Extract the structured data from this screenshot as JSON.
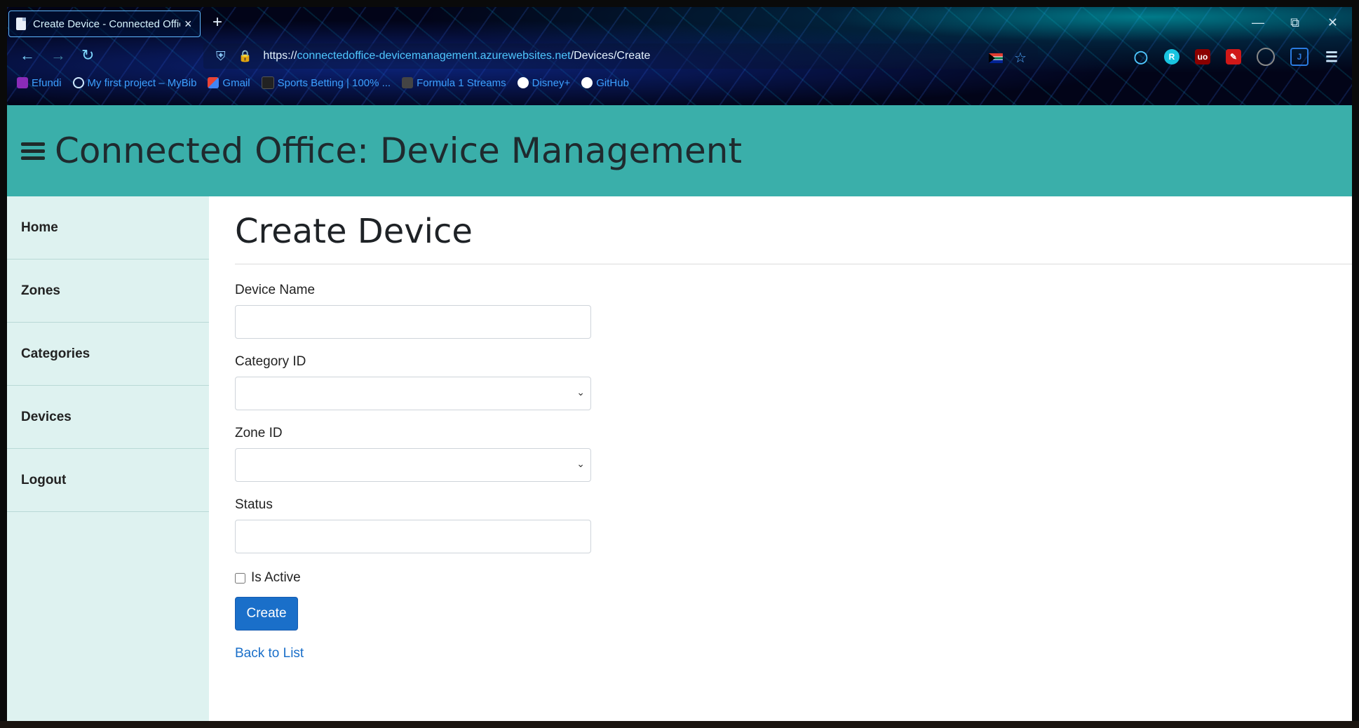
{
  "browser": {
    "tab_title": "Create Device - Connected Offic",
    "new_tab": "+",
    "tab_close": "×",
    "window_controls": {
      "minimize": "—",
      "restore": "⧉",
      "close": "✕"
    },
    "url_scheme": "https://",
    "url_host": "connectedoffice-devicemanagement.azurewebsites.net",
    "url_path": "/Devices/Create",
    "bookmarks": [
      {
        "label": "Efundi",
        "color": "#8a2bb8"
      },
      {
        "label": "My first project – MyBib",
        "color": "#3ca0ff"
      },
      {
        "label": "Gmail",
        "color": "#d93025"
      },
      {
        "label": "Sports Betting | 100% ...",
        "color": "#222222"
      },
      {
        "label": "Formula 1 Streams",
        "color": "#444444"
      },
      {
        "label": "Disney+",
        "color": "#ffffff"
      },
      {
        "label": "GitHub",
        "color": "#ffffff"
      }
    ]
  },
  "app": {
    "title": "Connected Office: Device Management",
    "accent": "#3aafaa"
  },
  "sidebar": {
    "items": [
      {
        "label": "Home"
      },
      {
        "label": "Zones"
      },
      {
        "label": "Categories"
      },
      {
        "label": "Devices"
      },
      {
        "label": "Logout"
      }
    ]
  },
  "form": {
    "heading": "Create Device",
    "device_name": {
      "label": "Device Name",
      "value": ""
    },
    "category_id": {
      "label": "Category ID",
      "value": ""
    },
    "zone_id": {
      "label": "Zone ID",
      "value": ""
    },
    "status": {
      "label": "Status",
      "value": ""
    },
    "is_active": {
      "label": "Is Active",
      "checked": false
    },
    "submit_label": "Create",
    "back_link": "Back to List"
  }
}
